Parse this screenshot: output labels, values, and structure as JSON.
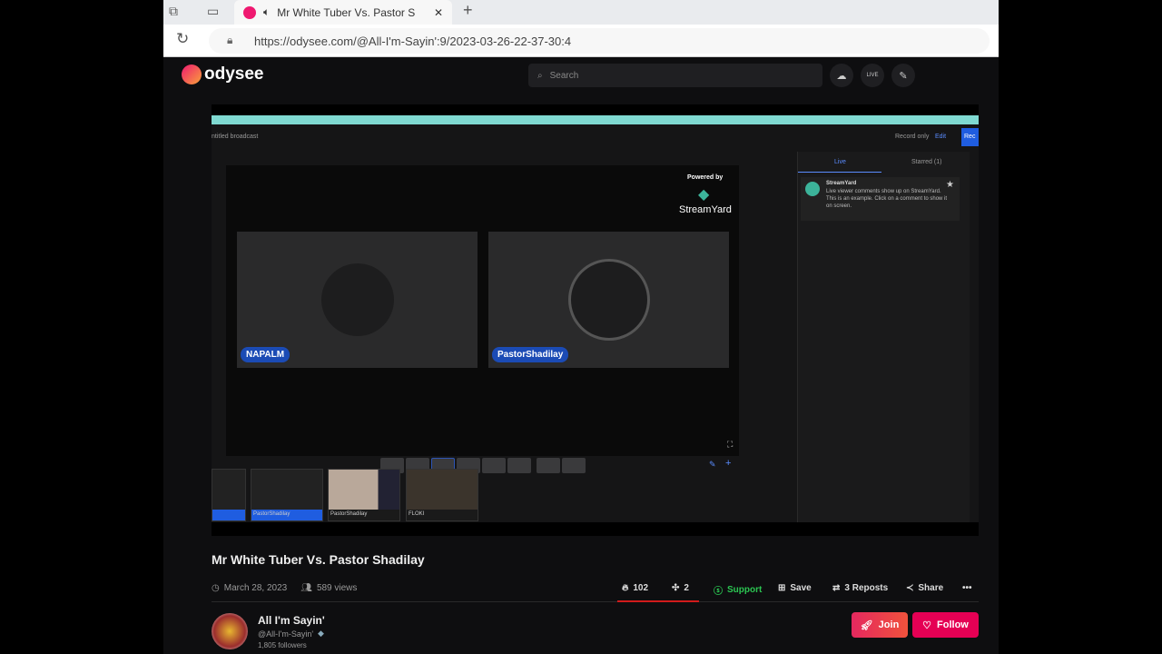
{
  "browser": {
    "tab_title": "Mr White Tuber Vs. Pastor S",
    "url": "https://odysee.com/@All-I'm-Sayin':9/2023-03-26-22-37-30:4"
  },
  "header": {
    "logo": "odysee",
    "search_placeholder": "Search",
    "live_label": "LIVE"
  },
  "streamyard": {
    "broadcast": "ntitled broadcast",
    "record_only": "Record only",
    "edit": "Edit",
    "record_btn": "Rec",
    "powered_by": "Powered by",
    "brand": "StreamYard",
    "tabs": [
      "Live",
      "Starred (1)"
    ],
    "comment_author": "StreamYard",
    "comment_text": "Live viewer comments show up on StreamYard. This is an example. Click on a comment to show it on screen.",
    "participants": [
      "NAPALM",
      "PastorShadilay"
    ],
    "thumbs": [
      "",
      "PastorShadilay",
      "PastorShadilay",
      "FLOKI"
    ]
  },
  "video": {
    "title": "Mr White Tuber Vs. Pastor Shadilay",
    "date": "March 28, 2023",
    "views": "589 views",
    "fire": "102",
    "slime": "2",
    "support": "Support",
    "save": "Save",
    "reposts": "3 Reposts",
    "share": "Share",
    "more": "•••",
    "like_ratio": 0.98
  },
  "channel": {
    "name": "All I'm Sayin'",
    "handle": "@All-I'm-Sayin'",
    "followers": "1,805 followers",
    "join": "Join",
    "follow": "Follow"
  },
  "colors": {
    "accent": "#e50054",
    "support": "#2bc652"
  }
}
